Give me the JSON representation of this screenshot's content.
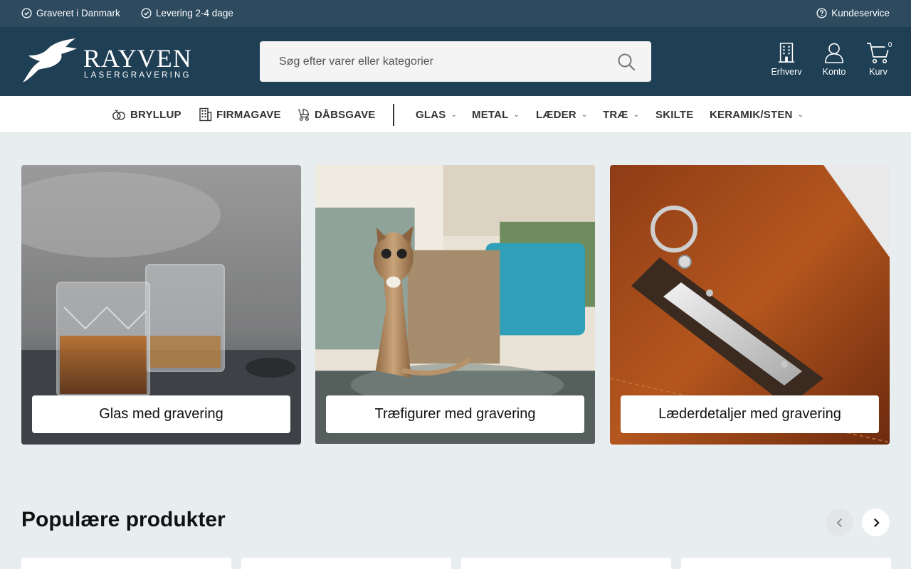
{
  "topbar": {
    "usps": [
      "Graveret i Danmark",
      "Levering 2-4 dage"
    ],
    "service": "Kundeservice"
  },
  "header": {
    "brand": "RAYVEN",
    "brand_sub": "LASERGRAVERING",
    "search_placeholder": "Søg efter varer eller kategorier",
    "business_label": "Erhverv",
    "account_label": "Konto",
    "cart_label": "Kurv",
    "cart_count": "0"
  },
  "nav": {
    "items": [
      {
        "label": "BRYLLUP",
        "icon": "rings-icon"
      },
      {
        "label": "FIRMAGAVE",
        "icon": "building-icon"
      },
      {
        "label": "DÅBSGAVE",
        "icon": "stroller-icon"
      },
      {
        "label": "GLAS",
        "dropdown": true
      },
      {
        "label": "METAL",
        "dropdown": true
      },
      {
        "label": "LÆDER",
        "dropdown": true
      },
      {
        "label": "TRÆ",
        "dropdown": true
      },
      {
        "label": "SKILTE",
        "dropdown": false
      },
      {
        "label": "KERAMIK/STEN",
        "dropdown": true
      }
    ]
  },
  "categories": [
    {
      "label": "Glas med gravering",
      "image": "whisky-glasses-photo"
    },
    {
      "label": "Træfigurer med gravering",
      "image": "wooden-cat-figure-photo"
    },
    {
      "label": "Læderdetaljer med gravering",
      "image": "leather-keychain-photo"
    }
  ],
  "popular": {
    "title": "Populære produkter"
  },
  "colors": {
    "topbar": "#2d4a5f",
    "header": "#1f3f55",
    "page_bg": "#e8eef0"
  }
}
